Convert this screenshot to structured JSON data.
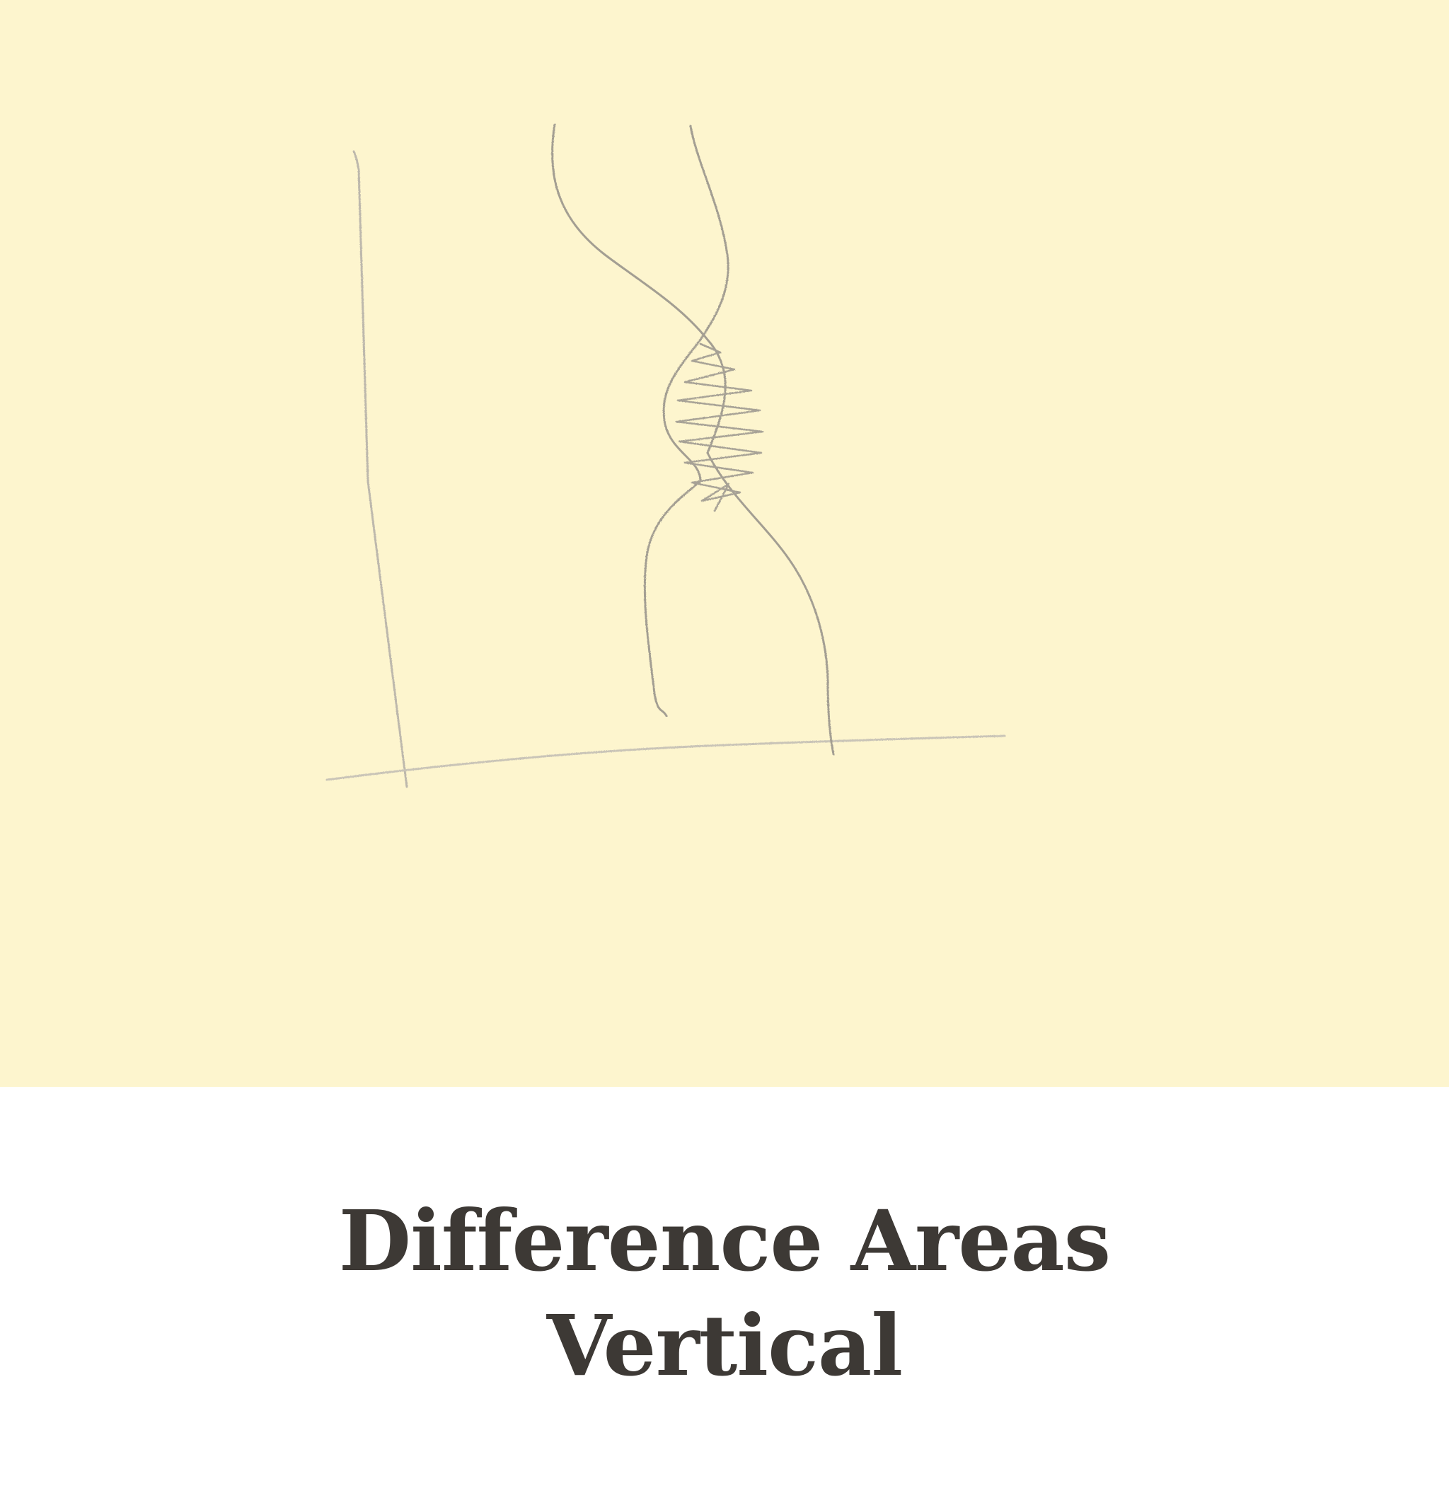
{
  "colors": {
    "panel_background": "#FDF5CE",
    "pencil": "#9A9589",
    "pencil_light": "#BDB8AC",
    "caption_text": "#3D3935"
  },
  "caption": {
    "line1": "Difference Areas",
    "line2": "Vertical"
  }
}
